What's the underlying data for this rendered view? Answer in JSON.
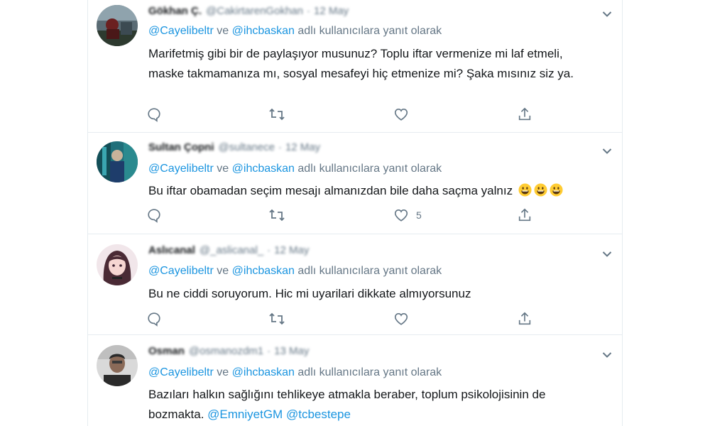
{
  "colors": {
    "link": "#1b95e0",
    "secondary_text": "#657786",
    "primary_text": "#14171a",
    "divider": "#e6ecf0"
  },
  "tweets": [
    {
      "display_name": "Gökhan Ç.",
      "handle": "@CakirtarenGokhan",
      "date": "12 May",
      "reply_to": [
        "@Cayelibeltr",
        "@ihcbaskan"
      ],
      "reply_join": "ve",
      "reply_suffix": "adlı kullanıcılara yanıt olarak",
      "text": "Marifetmiş gibi bir de paylaşıyor musunuz? Toplu iftar vermenize mi laf etmeli, maske takmamanıza mı, sosyal mesafeyi hiç etmenize mi? Şaka mısınız siz ya.",
      "like_count": ""
    },
    {
      "display_name": "Sultan Çopni",
      "handle": "@sultanece",
      "date": "12 May",
      "reply_to": [
        "@Cayelibeltr",
        "@ihcbaskan"
      ],
      "reply_join": "ve",
      "reply_suffix": "adlı kullanıcılara yanıt olarak",
      "text": "Bu iftar obamadan seçim mesajı almanızdan bile daha saçma yalnız",
      "emojis": [
        "grinning-face-emoji",
        "grinning-face-emoji",
        "grinning-face-emoji"
      ],
      "like_count": "5"
    },
    {
      "display_name": "Aslıcanal",
      "handle": "@_aslicanal_",
      "date": "12 May",
      "reply_to": [
        "@Cayelibeltr",
        "@ihcbaskan"
      ],
      "reply_join": "ve",
      "reply_suffix": "adlı kullanıcılara yanıt olarak",
      "text": "Bu ne ciddi soruyorum. Hic mi uyarilari dikkate almıyorsunuz",
      "like_count": ""
    },
    {
      "display_name": "Osman",
      "handle": "@osmanozdm1",
      "date": "13 May",
      "reply_to": [
        "@Cayelibeltr",
        "@ihcbaskan"
      ],
      "reply_join": "ve",
      "reply_suffix": "adlı kullanıcılara yanıt olarak",
      "text_main": "Bazıları halkın sağlığını tehlikeye atmakla beraber, toplum psikolojisinin de bozmakta.",
      "text_mentions": [
        "@EmniyetGM",
        "@tcbestepe"
      ]
    }
  ],
  "icons": {
    "reply": "reply-icon",
    "retweet": "retweet-icon",
    "like": "like-icon",
    "share": "share-icon",
    "caret": "chevron-down-icon"
  }
}
